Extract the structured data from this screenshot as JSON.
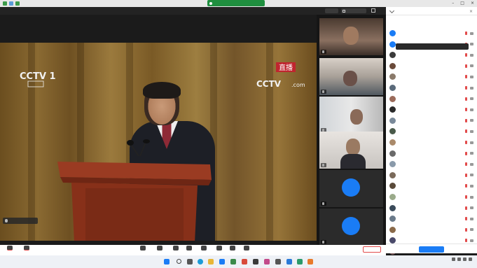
{
  "window": {
    "title": ""
  },
  "topbar": {
    "timer": "",
    "view_label": ""
  },
  "broadcast": {
    "channel_logo": "CCTV 1",
    "live_badge": "直播",
    "caption": ""
  },
  "video_tiles": [
    {
      "label": ""
    },
    {
      "label": ""
    },
    {
      "label": ""
    },
    {
      "label": ""
    },
    {
      "label": "",
      "avatar_text": "",
      "avatar_color": "#1a7cf5"
    },
    {
      "label": "",
      "avatar_text": "",
      "avatar_color": "#1a7cf5"
    }
  ],
  "panel": {
    "title": "",
    "presenter_tip": "",
    "participants": [
      {
        "name": "",
        "color": "#1a7cf5"
      },
      {
        "name": "",
        "color": "#1a7cf5"
      },
      {
        "name": "",
        "color": "#3b3b3b"
      },
      {
        "name": "",
        "color": "#6a4a3a"
      },
      {
        "name": "",
        "color": "#8a7a6a"
      },
      {
        "name": "",
        "color": "#5a6a7a"
      },
      {
        "name": "",
        "color": "#9a6a5a"
      },
      {
        "name": "",
        "color": "#2a2a2a"
      },
      {
        "name": "",
        "color": "#7a8a9a"
      },
      {
        "name": "",
        "color": "#4a5a4a"
      },
      {
        "name": "",
        "color": "#aa8a6a"
      },
      {
        "name": "",
        "color": "#6a6a6a"
      },
      {
        "name": "",
        "color": "#8a9aaa"
      },
      {
        "name": "",
        "color": "#7a6a5a"
      },
      {
        "name": "",
        "color": "#5a4a3a"
      },
      {
        "name": "",
        "color": "#9aaa8a"
      },
      {
        "name": "",
        "color": "#3a4a5a"
      },
      {
        "name": "",
        "color": "#6a7a8a"
      },
      {
        "name": "",
        "color": "#8a6a4a"
      },
      {
        "name": "",
        "color": "#4a4a6a"
      },
      {
        "name": "",
        "color": "#7a5a5a"
      },
      {
        "name": "",
        "color": "#5a7a6a"
      }
    ],
    "footer_end": "",
    "footer_join": ""
  },
  "toolbar": {
    "tools": [
      {
        "label": "",
        "icon": "mute-icon"
      },
      {
        "label": "",
        "icon": "video-icon"
      },
      {
        "label": "",
        "icon": "share-screen-icon"
      },
      {
        "label": "",
        "icon": "security-icon"
      },
      {
        "label": "",
        "icon": "participants-icon"
      },
      {
        "label": "",
        "icon": "chat-icon"
      },
      {
        "label": "",
        "icon": "record-icon"
      },
      {
        "label": "",
        "icon": "reactions-icon"
      },
      {
        "label": "",
        "icon": "apps-icon"
      },
      {
        "label": "",
        "icon": "settings-icon"
      }
    ]
  },
  "taskbar": {
    "weather_temp": "",
    "weather_desc": "",
    "time": "",
    "date": ""
  },
  "colors": {
    "accent": "#1a7cf5",
    "share_green": "#1f8f3f",
    "danger": "#e24b4b"
  }
}
